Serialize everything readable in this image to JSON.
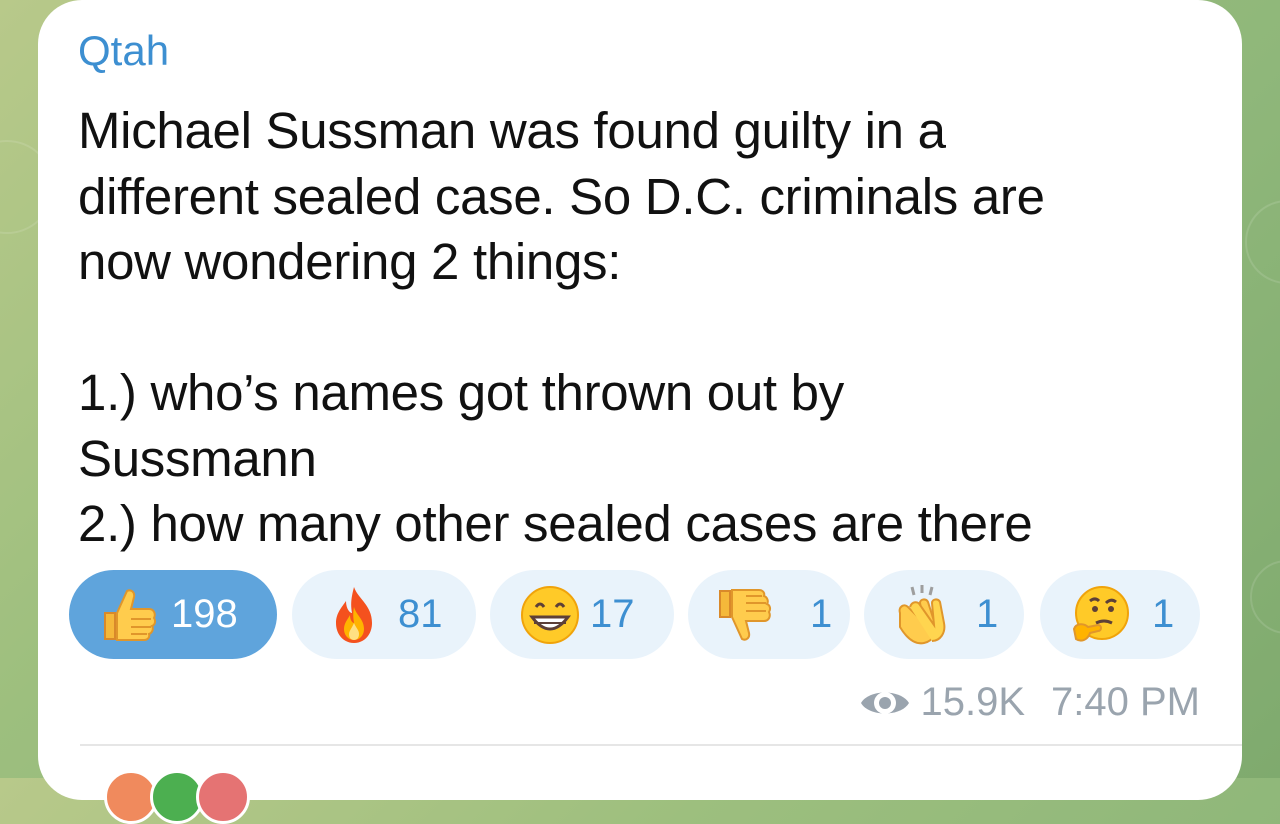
{
  "message": {
    "sender": "Qtah",
    "text": "Michael Sussman was found guilty in a\ndifferent sealed case. So D.C. criminals are\nnow wondering 2 things:\n\n1.) who’s names got thrown out by\nSussmann\n2.) how many other sealed cases are there",
    "views": "15.9K",
    "time": "7:40 PM"
  },
  "reactions": [
    {
      "emoji": "thumbs-up",
      "count": "198",
      "selected": true
    },
    {
      "emoji": "fire",
      "count": "81",
      "selected": false
    },
    {
      "emoji": "grinning-face",
      "count": "17",
      "selected": false
    },
    {
      "emoji": "thumbs-down",
      "count": "1",
      "selected": false
    },
    {
      "emoji": "clapping-hands",
      "count": "1",
      "selected": false
    },
    {
      "emoji": "thinking-face",
      "count": "1",
      "selected": false
    }
  ],
  "colors": {
    "accent": "#3d8fd1",
    "selected_reaction_bg": "#5fa4dc",
    "reaction_bg": "#e9f3fb",
    "meta_text": "#9aa4ae",
    "message_text": "#111111",
    "chat_background": "#9dbf7e"
  }
}
